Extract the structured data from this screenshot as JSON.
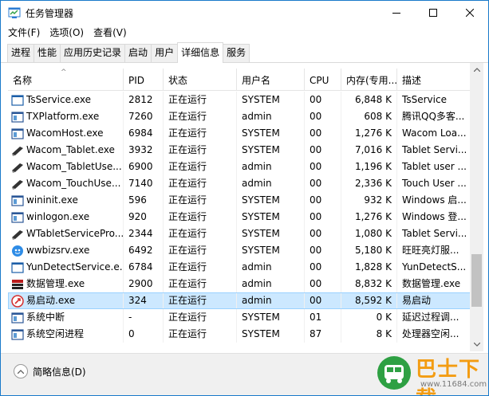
{
  "window": {
    "title": "任务管理器"
  },
  "menu": [
    "文件(F)",
    "选项(O)",
    "查看(V)"
  ],
  "tabs": [
    {
      "label": "进程",
      "active": false
    },
    {
      "label": "性能",
      "active": false
    },
    {
      "label": "应用历史记录",
      "active": false
    },
    {
      "label": "启动",
      "active": false
    },
    {
      "label": "用户",
      "active": false
    },
    {
      "label": "详细信息",
      "active": true
    },
    {
      "label": "服务",
      "active": false
    }
  ],
  "columns": {
    "name": "名称",
    "pid": "PID",
    "status": "状态",
    "user": "用户名",
    "cpu": "CPU",
    "memory": "内存(专用...",
    "desc": "描述"
  },
  "rows": [
    {
      "name": "TsService.exe",
      "pid": "2812",
      "status": "正在运行",
      "user": "SYSTEM",
      "cpu": "00",
      "memory": "6,848 K",
      "desc": "TsService",
      "icon": "window-icon",
      "selected": false
    },
    {
      "name": "TXPlatform.exe",
      "pid": "7260",
      "status": "正在运行",
      "user": "admin",
      "cpu": "00",
      "memory": "608 K",
      "desc": "腾讯QQ多客...",
      "icon": "app-window-icon",
      "selected": false
    },
    {
      "name": "WacomHost.exe",
      "pid": "6984",
      "status": "正在运行",
      "user": "SYSTEM",
      "cpu": "00",
      "memory": "1,276 K",
      "desc": "Wacom Loa...",
      "icon": "app-window-icon",
      "selected": false
    },
    {
      "name": "Wacom_Tablet.exe",
      "pid": "3932",
      "status": "正在运行",
      "user": "SYSTEM",
      "cpu": "00",
      "memory": "7,016 K",
      "desc": "Tablet Servi...",
      "icon": "pen-icon",
      "selected": false
    },
    {
      "name": "Wacom_TabletUse...",
      "pid": "6900",
      "status": "正在运行",
      "user": "admin",
      "cpu": "00",
      "memory": "1,196 K",
      "desc": "Tablet user ...",
      "icon": "pen-icon",
      "selected": false
    },
    {
      "name": "Wacom_TouchUse...",
      "pid": "7140",
      "status": "正在运行",
      "user": "admin",
      "cpu": "00",
      "memory": "2,336 K",
      "desc": "Touch User ...",
      "icon": "pen-icon",
      "selected": false
    },
    {
      "name": "wininit.exe",
      "pid": "596",
      "status": "正在运行",
      "user": "SYSTEM",
      "cpu": "00",
      "memory": "932 K",
      "desc": "Windows 启...",
      "icon": "app-window-icon",
      "selected": false
    },
    {
      "name": "winlogon.exe",
      "pid": "920",
      "status": "正在运行",
      "user": "SYSTEM",
      "cpu": "00",
      "memory": "1,276 K",
      "desc": "Windows 登...",
      "icon": "app-window-icon",
      "selected": false
    },
    {
      "name": "WTabletServicePro...",
      "pid": "2344",
      "status": "正在运行",
      "user": "SYSTEM",
      "cpu": "00",
      "memory": "1,080 K",
      "desc": "Tablet Servi...",
      "icon": "pen-icon",
      "selected": false
    },
    {
      "name": "wwbizsrv.exe",
      "pid": "6492",
      "status": "正在运行",
      "user": "SYSTEM",
      "cpu": "00",
      "memory": "5,180 K",
      "desc": "旺旺亮灯服...",
      "icon": "wangwang-icon",
      "selected": false
    },
    {
      "name": "YunDetectService.e...",
      "pid": "6784",
      "status": "正在运行",
      "user": "admin",
      "cpu": "00",
      "memory": "1,828 K",
      "desc": "YunDetectS...",
      "icon": "window-icon",
      "selected": false
    },
    {
      "name": "数据管理.exe",
      "pid": "2900",
      "status": "正在运行",
      "user": "admin",
      "cpu": "00",
      "memory": "8,832 K",
      "desc": "数据管理.exe",
      "icon": "database-icon",
      "selected": false
    },
    {
      "name": "易启动.exe",
      "pid": "324",
      "status": "正在运行",
      "user": "admin",
      "cpu": "00",
      "memory": "8,592 K",
      "desc": "易启动",
      "icon": "rocket-icon",
      "selected": true
    },
    {
      "name": "系统中断",
      "pid": "-",
      "status": "正在运行",
      "user": "SYSTEM",
      "cpu": "01",
      "memory": "0 K",
      "desc": "延迟过程调...",
      "icon": "app-window-icon",
      "selected": false
    },
    {
      "name": "系统空闲进程",
      "pid": "0",
      "status": "正在运行",
      "user": "SYSTEM",
      "cpu": "87",
      "memory": "8 K",
      "desc": "处理器空闲...",
      "icon": "app-window-icon",
      "selected": false
    }
  ],
  "scrollbar": {
    "position": 0.85,
    "visible_fraction": 0.2
  },
  "footer": {
    "fewer_details": "简略信息(D)"
  },
  "watermark": {
    "brand": "巴士下载",
    "url": "www.11684.com"
  },
  "colors": {
    "selection": "#cce8ff",
    "accent": "#1979ca",
    "watermark": "#f39c12"
  }
}
